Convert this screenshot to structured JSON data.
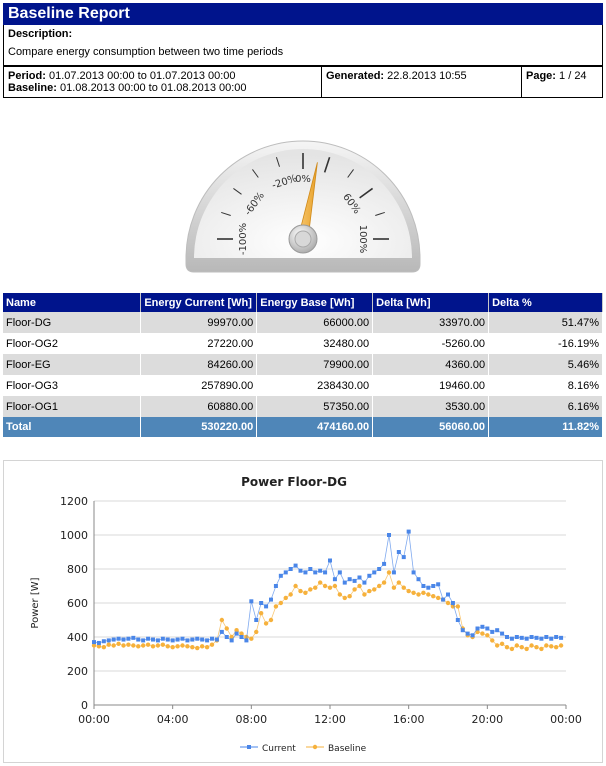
{
  "header": {
    "title": "Baseline Report"
  },
  "description": {
    "label": "Description:",
    "text": "Compare energy consumption between two time periods"
  },
  "meta": {
    "period_label": "Period:",
    "period_value": "01.07.2013 00:00 to 01.07.2013 00:00",
    "baseline_label": "Baseline:",
    "baseline_value": "01.08.2013 00:00 to 01.08.2013 00:00",
    "generated_label": "Generated:",
    "generated_value": "22.8.2013 10:55",
    "page_label": "Page:",
    "page_value": "1 / 24"
  },
  "gauge": {
    "ticks": [
      "-100%",
      "-60%",
      "-20%",
      "0%",
      "60%",
      "100%"
    ],
    "value_percent": 11.82,
    "colors": {
      "needle": "#f3b34a",
      "face": "#f2f2f2",
      "rim": "#c8c8c8"
    }
  },
  "table": {
    "headers": [
      "Name",
      "Energy Current [Wh]",
      "Energy Base [Wh]",
      "Delta [Wh]",
      "Delta %"
    ],
    "rows": [
      [
        "Floor-DG",
        "99970.00",
        "66000.00",
        "33970.00",
        "51.47%"
      ],
      [
        "Floor-OG2",
        "27220.00",
        "32480.00",
        "-5260.00",
        "-16.19%"
      ],
      [
        "Floor-EG",
        "84260.00",
        "79900.00",
        "4360.00",
        "5.46%"
      ],
      [
        "Floor-OG3",
        "257890.00",
        "238430.00",
        "19460.00",
        "8.16%"
      ],
      [
        "Floor-OG1",
        "60880.00",
        "57350.00",
        "3530.00",
        "6.16%"
      ]
    ],
    "total": [
      "Total",
      "530220.00",
      "474160.00",
      "56060.00",
      "11.82%"
    ],
    "colors": {
      "header_bg": "#00148c",
      "total_bg": "#4f86b8",
      "odd_row": "#dcdcdc"
    }
  },
  "chart_data": {
    "type": "line",
    "title": "Power Floor-DG",
    "xlabel": "",
    "ylabel": "Power [W]",
    "ylim": [
      0,
      1200
    ],
    "yticks": [
      "0",
      "200",
      "400",
      "600",
      "800",
      "1000",
      "1200"
    ],
    "xlim_hours": [
      0,
      24
    ],
    "xticks": [
      "00:00",
      "04:00",
      "08:00",
      "12:00",
      "16:00",
      "20:00",
      "00:00"
    ],
    "x_unit": "hours",
    "x_hours": [
      0,
      0.25,
      0.5,
      0.75,
      1,
      1.25,
      1.5,
      1.75,
      2,
      2.25,
      2.5,
      2.75,
      3,
      3.25,
      3.5,
      3.75,
      4,
      4.25,
      4.5,
      4.75,
      5,
      5.25,
      5.5,
      5.75,
      6,
      6.25,
      6.5,
      6.75,
      7,
      7.25,
      7.5,
      7.75,
      8,
      8.25,
      8.5,
      8.75,
      9,
      9.25,
      9.5,
      9.75,
      10,
      10.25,
      10.5,
      10.75,
      11,
      11.25,
      11.5,
      11.75,
      12,
      12.25,
      12.5,
      12.75,
      13,
      13.25,
      13.5,
      13.75,
      14,
      14.25,
      14.5,
      14.75,
      15,
      15.25,
      15.5,
      15.75,
      16,
      16.25,
      16.5,
      16.75,
      17,
      17.25,
      17.5,
      17.75,
      18,
      18.25,
      18.5,
      18.75,
      19,
      19.25,
      19.5,
      19.75,
      20,
      20.25,
      20.5,
      20.75,
      21,
      21.25,
      21.5,
      21.75,
      22,
      22.25,
      22.5,
      22.75,
      23,
      23.25,
      23.5,
      23.75
    ],
    "series": [
      {
        "name": "Current",
        "color": "#4a86e8",
        "marker": "square",
        "values": [
          370,
          365,
          375,
          380,
          385,
          390,
          385,
          390,
          395,
          385,
          380,
          390,
          385,
          380,
          390,
          385,
          380,
          385,
          390,
          380,
          385,
          390,
          385,
          380,
          390,
          385,
          430,
          400,
          380,
          420,
          400,
          380,
          610,
          500,
          600,
          580,
          620,
          700,
          760,
          780,
          800,
          820,
          790,
          780,
          800,
          780,
          790,
          780,
          850,
          740,
          780,
          720,
          740,
          730,
          750,
          720,
          760,
          780,
          800,
          830,
          1000,
          780,
          900,
          870,
          1020,
          780,
          740,
          700,
          690,
          700,
          710,
          620,
          650,
          600,
          500,
          440,
          420,
          410,
          450,
          460,
          450,
          430,
          440,
          420,
          400,
          390,
          400,
          395,
          390,
          400,
          395,
          390,
          400,
          390,
          400,
          395
        ]
      },
      {
        "name": "Baseline",
        "color": "#f6b13c",
        "marker": "circle",
        "values": [
          350,
          345,
          340,
          355,
          350,
          360,
          350,
          355,
          350,
          345,
          350,
          355,
          345,
          350,
          355,
          345,
          340,
          345,
          350,
          345,
          340,
          335,
          345,
          340,
          355,
          380,
          500,
          450,
          400,
          440,
          420,
          400,
          390,
          430,
          540,
          480,
          500,
          580,
          600,
          630,
          650,
          700,
          670,
          660,
          680,
          690,
          720,
          700,
          690,
          700,
          650,
          630,
          640,
          680,
          700,
          650,
          670,
          680,
          700,
          720,
          780,
          690,
          720,
          690,
          670,
          660,
          650,
          660,
          650,
          640,
          630,
          620,
          600,
          580,
          580,
          450,
          410,
          400,
          430,
          420,
          410,
          380,
          350,
          360,
          340,
          330,
          350,
          340,
          330,
          350,
          340,
          330,
          350,
          345,
          340,
          350
        ]
      }
    ],
    "legend": {
      "position": "bottom",
      "entries": [
        "Current",
        "Baseline"
      ]
    },
    "grid": true
  }
}
